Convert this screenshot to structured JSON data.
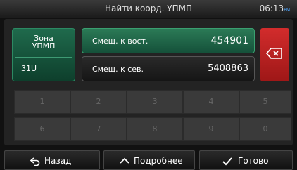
{
  "header": {
    "title": "Найти коорд. УПМП",
    "time": "06:13",
    "time_suffix": "PM"
  },
  "zone": {
    "label": "Зона\nУПМП",
    "value": "31U"
  },
  "fields": [
    {
      "label": "Смещ. к вост.",
      "value": "454901",
      "active": true
    },
    {
      "label": "Смещ. к сев.",
      "value": "5408863",
      "active": false
    }
  ],
  "keypad": {
    "keys": [
      "1",
      "2",
      "3",
      "4",
      "5",
      "6",
      "7",
      "8",
      "9",
      "0"
    ],
    "enabled": false
  },
  "footer": {
    "back_label": "Назад",
    "more_label": "Подробнее",
    "done_label": "Готово"
  },
  "colors": {
    "active_field": "#1f6a4c",
    "backspace": "#d22c2c",
    "clock_suffix": "#4da6ff"
  },
  "icons": {
    "backspace": "backspace-icon",
    "back": "back-arrow-icon",
    "more": "chevron-up-icon",
    "done": "checkmark-icon"
  }
}
